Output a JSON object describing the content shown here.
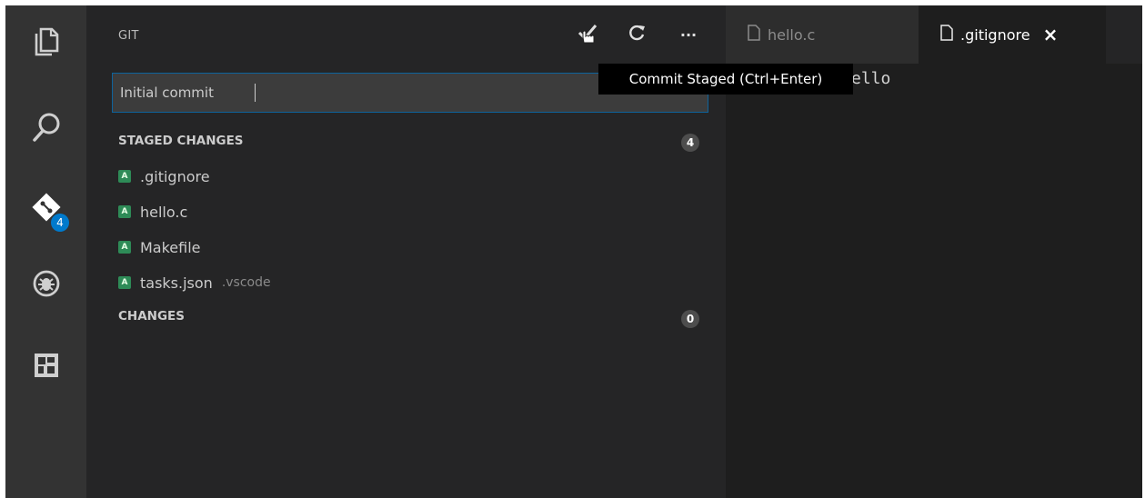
{
  "activity_bar": {
    "items": [
      {
        "icon": "files-icon"
      },
      {
        "icon": "search-icon"
      },
      {
        "icon": "git-icon",
        "badge": "4"
      },
      {
        "icon": "debug-icon"
      },
      {
        "icon": "extensions-icon"
      }
    ]
  },
  "sidebar": {
    "title": "GIT",
    "toolbar": {
      "commit_icon": "commit-check-icon",
      "refresh_icon": "refresh-icon",
      "more_label": "···"
    },
    "commit_message": "Initial commit",
    "staged": {
      "header": "STAGED CHANGES",
      "count": "4",
      "files": [
        {
          "status": "A",
          "name": ".gitignore",
          "dir": ""
        },
        {
          "status": "A",
          "name": "hello.c",
          "dir": ""
        },
        {
          "status": "A",
          "name": "Makefile",
          "dir": ""
        },
        {
          "status": "A",
          "name": "tasks.json",
          "dir": ".vscode"
        }
      ]
    },
    "changes": {
      "header": "CHANGES",
      "count": "0"
    }
  },
  "editor": {
    "tabs": [
      {
        "label": "hello.c",
        "active": false
      },
      {
        "label": ".gitignore",
        "active": true,
        "close": "×"
      }
    ],
    "visible_text": "ello"
  },
  "tooltip": "Commit Staged (Ctrl+Enter)",
  "colors": {
    "activity_bg": "#333333",
    "sidebar_bg": "#252526",
    "editor_bg": "#1e1e1e",
    "badge_blue": "#007acc",
    "status_added": "#2e8b57"
  }
}
